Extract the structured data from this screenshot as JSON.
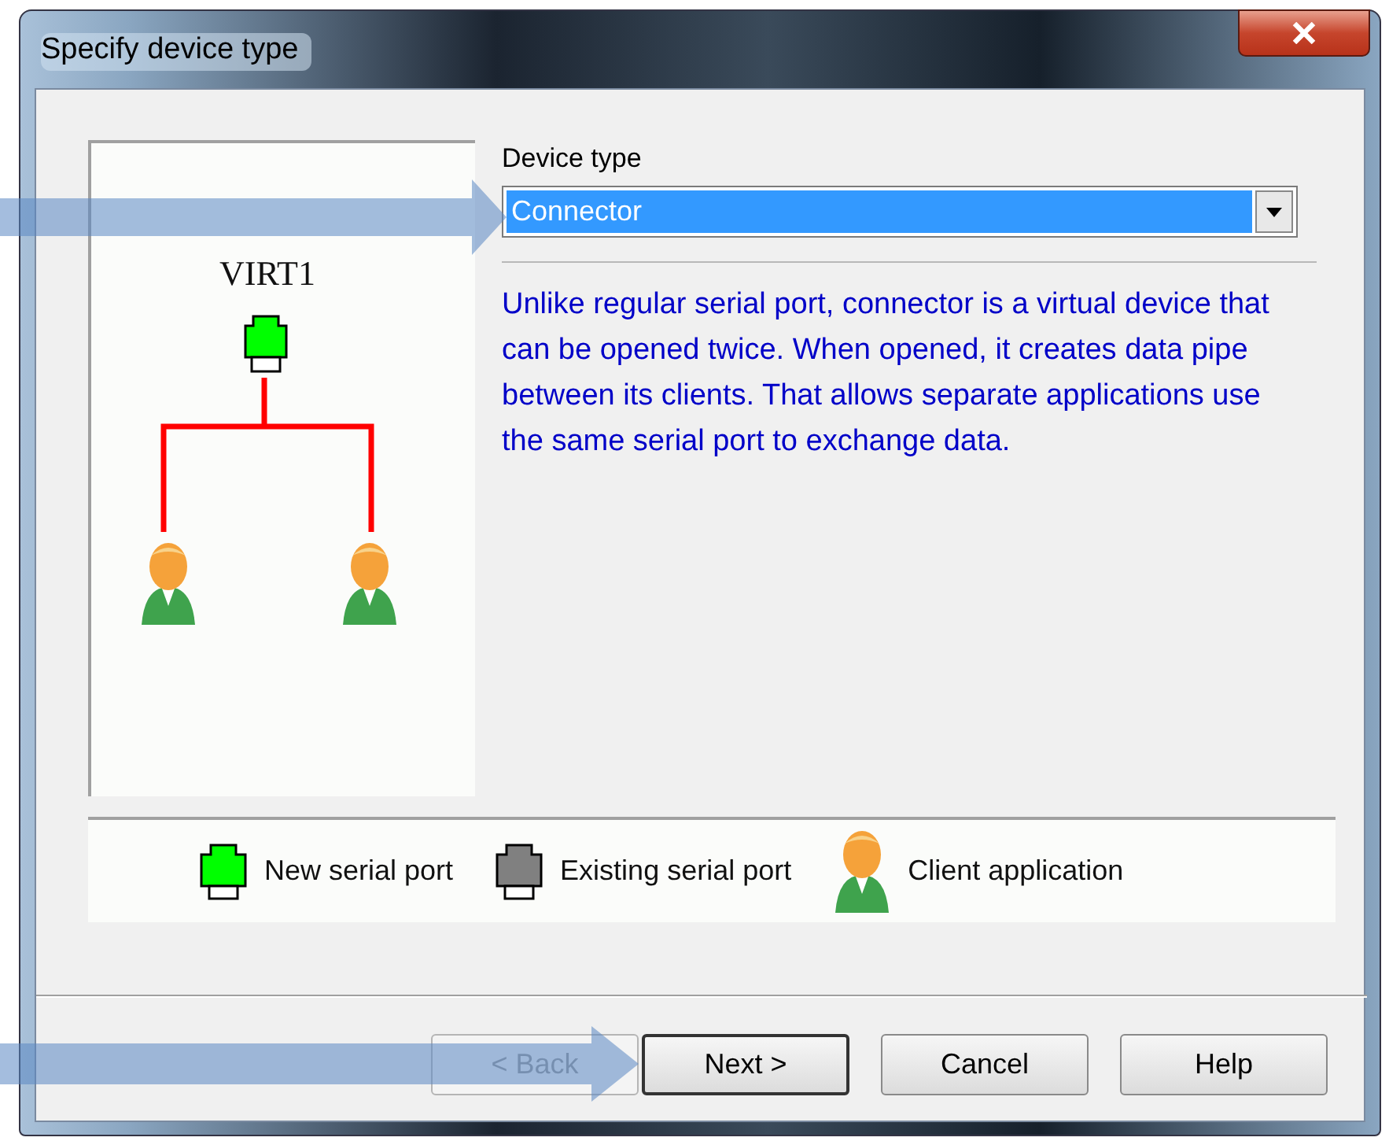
{
  "window": {
    "title": "Specify device type"
  },
  "diagram": {
    "device_label": "VIRT1"
  },
  "device_type": {
    "label": "Device type",
    "value": "Connector"
  },
  "description": "Unlike regular serial port, connector is a virtual device that can be opened twice. When opened, it creates data pipe between its clients. That allows separate applications use the same serial port to exchange data.",
  "legend": [
    {
      "kind": "port",
      "color": "#00ff00",
      "label": "New serial port"
    },
    {
      "kind": "port",
      "color": "#808080",
      "label": "Existing serial port"
    },
    {
      "kind": "client",
      "label": "Client application"
    }
  ],
  "buttons": [
    {
      "label": "< Back",
      "disabled": true,
      "default": false
    },
    {
      "label": "Next >",
      "disabled": false,
      "default": true
    },
    {
      "label": "Cancel",
      "disabled": false,
      "default": false
    },
    {
      "label": "Help",
      "disabled": false,
      "default": false
    }
  ]
}
